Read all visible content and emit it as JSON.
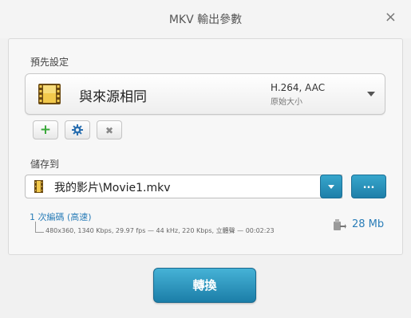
{
  "window": {
    "title": "MKV 輸出參數",
    "close_glyph": "×"
  },
  "preset": {
    "section_label": "預先設定",
    "name": "與來源相同",
    "codec": "H.264, AAC",
    "size_label": "原始大小"
  },
  "preset_buttons": [
    {
      "icon": "plus-icon",
      "glyph": "+",
      "color": "#3aa83a"
    },
    {
      "icon": "gear-icon",
      "color": "#2a6fb0"
    },
    {
      "icon": "close-icon",
      "glyph": "✖",
      "color": "#888888"
    }
  ],
  "save": {
    "section_label": "儲存到",
    "path": "我的影片\\Movie1.mkv",
    "browse_label": "..."
  },
  "encoding": {
    "link": "1 次編碼 (高速)",
    "details": "480x360, 1340 Kbps, 29.97 fps — 44 kHz, 220 Kbps, 立體聲 — 00:02:23",
    "file_size": "28 Mb"
  },
  "convert_button": "轉換",
  "colors": {
    "accent": "#1e7fa9",
    "link": "#2a7db8"
  }
}
